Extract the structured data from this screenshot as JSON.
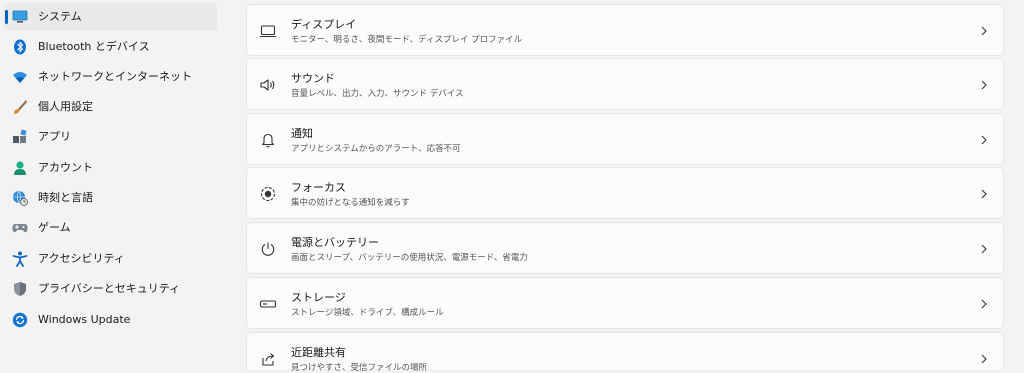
{
  "sidebar": {
    "items": [
      {
        "label": "システム",
        "icon": "system-monitor-icon",
        "selected": true
      },
      {
        "label": "Bluetooth とデバイス",
        "icon": "bluetooth-icon"
      },
      {
        "label": "ネットワークとインターネット",
        "icon": "wifi-icon"
      },
      {
        "label": "個人用設定",
        "icon": "paintbrush-icon"
      },
      {
        "label": "アプリ",
        "icon": "apps-icon"
      },
      {
        "label": "アカウント",
        "icon": "person-icon"
      },
      {
        "label": "時刻と言語",
        "icon": "globe-clock-icon"
      },
      {
        "label": "ゲーム",
        "icon": "gamepad-icon"
      },
      {
        "label": "アクセシビリティ",
        "icon": "accessibility-icon"
      },
      {
        "label": "プライバシーとセキュリティ",
        "icon": "shield-icon"
      },
      {
        "label": "Windows Update",
        "icon": "windows-update-icon"
      }
    ]
  },
  "main": {
    "cards": [
      {
        "title": "ディスプレイ",
        "subtitle": "モニター、明るさ、夜間モード、ディスプレイ プロファイル",
        "icon": "display-icon"
      },
      {
        "title": "サウンド",
        "subtitle": "音量レベル、出力、入力、サウンド デバイス",
        "icon": "speaker-icon"
      },
      {
        "title": "通知",
        "subtitle": "アプリとシステムからのアラート、応答不可",
        "icon": "bell-icon"
      },
      {
        "title": "フォーカス",
        "subtitle": "集中の妨げとなる通知を減らす",
        "icon": "focus-icon"
      },
      {
        "title": "電源とバッテリー",
        "subtitle": "画面とスリープ、バッテリーの使用状況、電源モード、省電力",
        "icon": "power-icon"
      },
      {
        "title": "ストレージ",
        "subtitle": "ストレージ領域、ドライブ、構成ルール",
        "icon": "storage-icon"
      },
      {
        "title": "近距離共有",
        "subtitle": "見つけやすさ、受信ファイルの場所",
        "icon": "share-icon"
      }
    ]
  },
  "colors": {
    "accent": "#0067c0",
    "background": "#f3f3f3",
    "card": "#fbfbfb"
  }
}
